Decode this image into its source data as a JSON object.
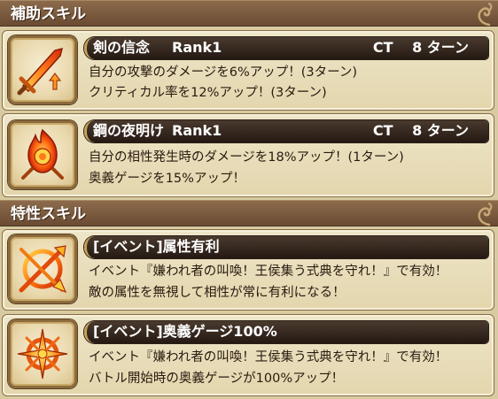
{
  "sections": {
    "support": {
      "title": "補助スキル"
    },
    "trait": {
      "title": "特性スキル"
    }
  },
  "skills": [
    {
      "name": "剣の信念",
      "rank": "Rank1",
      "ct": "CT　 8 ターン",
      "lines": [
        "自分の攻撃のダメージを6%アップ！(3ターン)",
        "クリティカル率を12%アップ！(3ターン)"
      ],
      "icon": "flaming-sword-icon"
    },
    {
      "name": "鋼の夜明け",
      "rank": "Rank1",
      "ct": "CT　 8 ターン",
      "lines": [
        "自分の相性発生時のダメージを18%アップ！(1ターン)",
        "奥義ゲージを15%アップ！"
      ],
      "icon": "flame-emblem-icon"
    }
  ],
  "traits": [
    {
      "name": "[イベント]属性有利",
      "lines": [
        "イベント『嫌われ者の叫喚！王侯集う式典を守れ！』で有効！",
        "敵の属性を無視して相性が常に有利になる！"
      ],
      "icon": "crossed-arrows-icon"
    },
    {
      "name": "[イベント]奥義ゲージ100%",
      "lines": [
        "イベント『嫌われ者の叫喚！王侯集う式典を守れ！』で有効！",
        "バトル開始時の奥義ゲージが100%アップ！"
      ],
      "icon": "compass-star-icon"
    }
  ]
}
